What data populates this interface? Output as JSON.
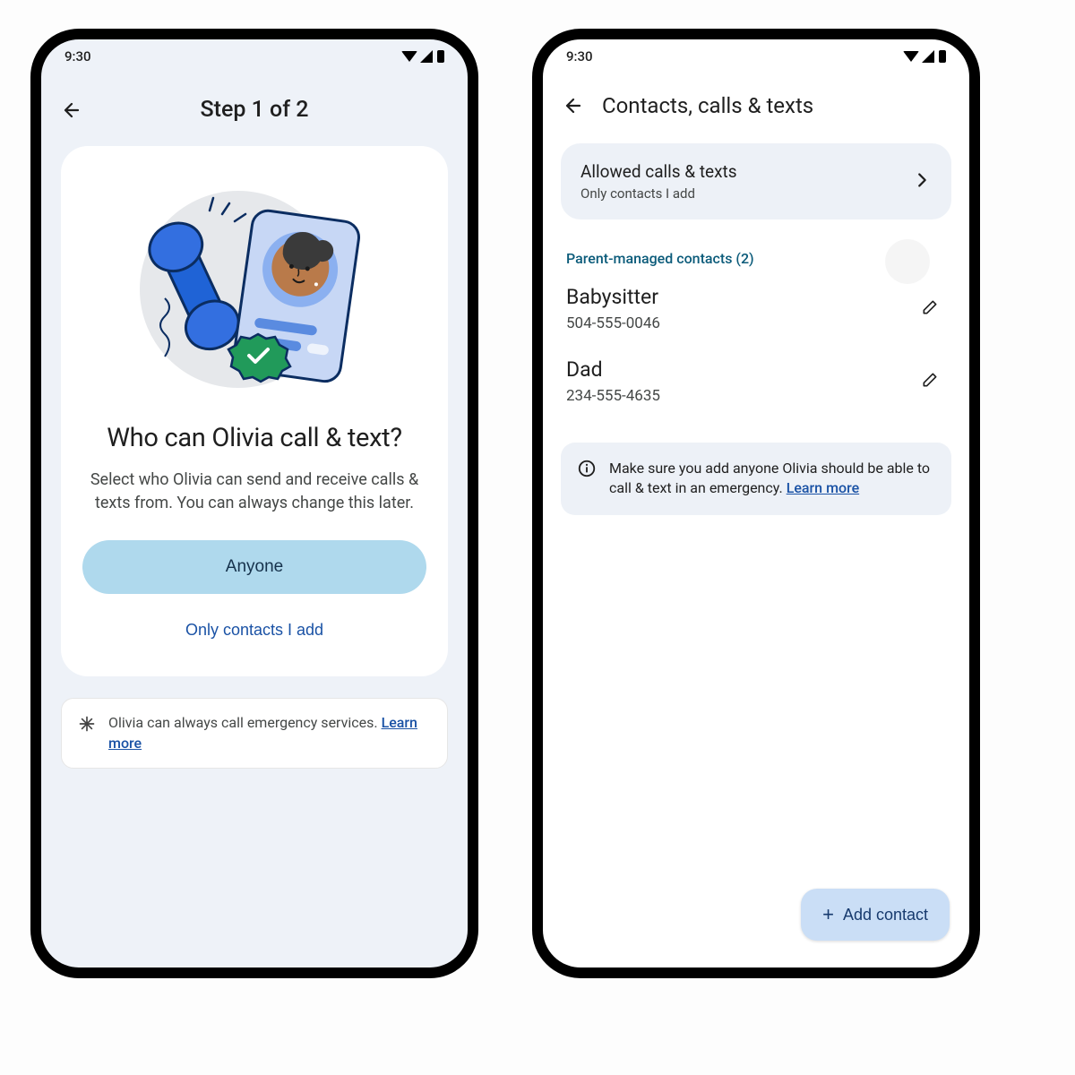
{
  "status": {
    "time": "9:30"
  },
  "left": {
    "header": {
      "title": "Step 1 of 2"
    },
    "card": {
      "title": "Who can Olivia call & text?",
      "description": "Select who Olivia can send and receive calls & texts from. You can always change this later.",
      "primary_btn": "Anyone",
      "secondary_btn": "Only contacts I add"
    },
    "footer": {
      "text": "Olivia can always call emergency services. ",
      "learn_more": "Learn more"
    }
  },
  "right": {
    "header": {
      "title": "Contacts, calls & texts"
    },
    "allowed": {
      "title": "Allowed calls & texts",
      "subtitle": "Only contacts I add"
    },
    "section_label": "Parent-managed contacts (2)",
    "contacts": [
      {
        "name": "Babysitter",
        "phone": "504-555-0046"
      },
      {
        "name": "Dad",
        "phone": "234-555-4635"
      }
    ],
    "info": {
      "text": "Make sure you add anyone Olivia should be able to call & text in an emergency. ",
      "learn_more": "Learn more"
    },
    "add_btn": "Add contact"
  }
}
